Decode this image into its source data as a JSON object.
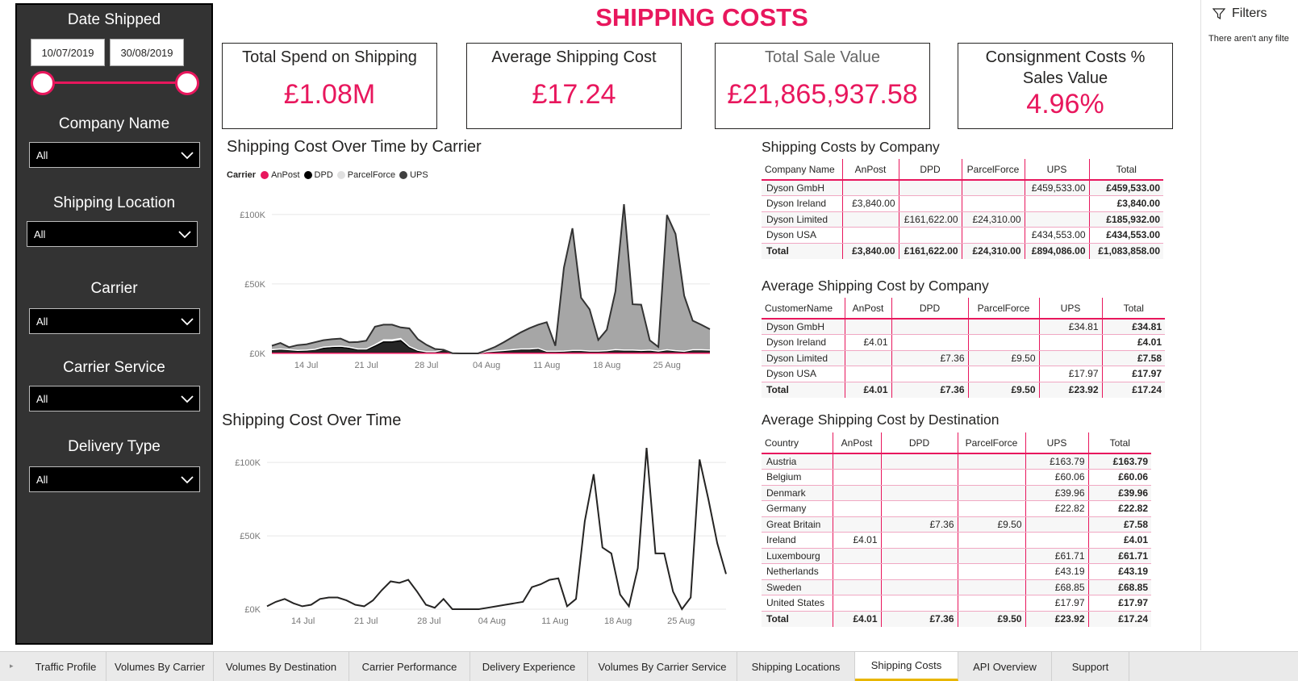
{
  "page": {
    "title": "SHIPPING COSTS"
  },
  "slicers": {
    "date_shipped": {
      "title": "Date Shipped",
      "start": "10/07/2019",
      "end": "30/08/2019"
    },
    "company_name": {
      "title": "Company Name",
      "value": "All"
    },
    "shipping_location": {
      "title": "Shipping Location",
      "value": "All"
    },
    "carrier": {
      "title": "Carrier",
      "value": "All"
    },
    "carrier_service": {
      "title": "Carrier Service",
      "value": "All"
    },
    "delivery_type": {
      "title": "Delivery Type",
      "value": "All"
    }
  },
  "cards": [
    {
      "label": "Total Spend on Shipping",
      "value": "£1.08M"
    },
    {
      "label": "Average Shipping Cost",
      "value": "£17.24"
    },
    {
      "label": "Total Sale Value",
      "value": "£21,865,937.58"
    },
    {
      "label": "Consignment Costs % Sales Value",
      "value": "4.96%"
    }
  ],
  "filters_pane": {
    "title": "Filters",
    "empty_text": "There aren't any filte"
  },
  "colors": {
    "accent": "#e8175d",
    "sidebar": "#333333",
    "anpost": "#e8175d",
    "dpd": "#000000",
    "parcelforce": "#e0e0e0",
    "ups": "#404040"
  },
  "chart_data": [
    {
      "type": "area",
      "title": "Shipping Cost Over Time by Carrier",
      "legend_title": "Carrier",
      "legend_position": "top-left",
      "x_ticks": [
        "14 Jul",
        "21 Jul",
        "28 Jul",
        "04 Aug",
        "11 Aug",
        "18 Aug",
        "25 Aug"
      ],
      "y_ticks": [
        "£0K",
        "£50K",
        "£100K"
      ],
      "ylim": [
        0,
        115000
      ],
      "grid": true,
      "stacked": true,
      "x_dates": [
        "10 Jul",
        "11 Jul",
        "12 Jul",
        "13 Jul",
        "14 Jul",
        "15 Jul",
        "16 Jul",
        "17 Jul",
        "18 Jul",
        "19 Jul",
        "20 Jul",
        "21 Jul",
        "22 Jul",
        "23 Jul",
        "24 Jul",
        "25 Jul",
        "26 Jul",
        "27 Jul",
        "28 Jul",
        "29 Jul",
        "30 Jul",
        "31 Jul",
        "01 Aug",
        "02 Aug",
        "03 Aug",
        "04 Aug",
        "05 Aug",
        "06 Aug",
        "07 Aug",
        "08 Aug",
        "09 Aug",
        "10 Aug",
        "11 Aug",
        "12 Aug",
        "13 Aug",
        "14 Aug",
        "15 Aug",
        "16 Aug",
        "17 Aug",
        "18 Aug",
        "19 Aug",
        "20 Aug",
        "21 Aug",
        "22 Aug",
        "23 Aug",
        "24 Aug",
        "25 Aug",
        "26 Aug",
        "27 Aug",
        "28 Aug",
        "29 Aug",
        "30 Aug"
      ],
      "series": [
        {
          "name": "AnPost",
          "values": [
            200,
            200,
            200,
            200,
            200,
            200,
            200,
            200,
            200,
            200,
            200,
            200,
            200,
            200,
            200,
            200,
            200,
            200,
            200,
            200,
            200,
            200,
            0,
            0,
            0,
            200,
            200,
            200,
            200,
            200,
            200,
            200,
            200,
            200,
            200,
            200,
            200,
            200,
            200,
            200,
            200,
            200,
            200,
            200,
            200,
            200,
            200,
            200,
            200,
            200,
            200,
            200
          ]
        },
        {
          "name": "DPD",
          "values": [
            2000,
            2500,
            2000,
            1500,
            1700,
            2200,
            3500,
            4000,
            4200,
            3500,
            2500,
            2500,
            5000,
            8000,
            8000,
            9000,
            4000,
            1500,
            800,
            800,
            2000,
            0,
            0,
            0,
            0,
            800,
            1200,
            1500,
            2000,
            2500,
            2500,
            3000,
            1000,
            1000,
            1200,
            1500,
            1500,
            1200,
            1200,
            1500,
            2000,
            1800,
            1800,
            1500,
            1800,
            1200,
            2000,
            1500,
            1000,
            2000,
            2000,
            1800
          ]
        },
        {
          "name": "ParcelForce",
          "values": [
            500,
            500,
            500,
            500,
            500,
            500,
            800,
            800,
            800,
            800,
            500,
            500,
            1000,
            1500,
            1500,
            1500,
            800,
            500,
            200,
            200,
            400,
            0,
            0,
            0,
            0,
            200,
            300,
            400,
            500,
            500,
            500,
            500,
            300,
            300,
            300,
            400,
            400,
            300,
            300,
            300,
            500,
            400,
            400,
            400,
            400,
            300,
            400,
            300,
            300,
            400,
            400,
            400
          ]
        },
        {
          "name": "UPS",
          "values": [
            2800,
            4300,
            1800,
            3800,
            4100,
            5100,
            5000,
            5200,
            5500,
            3500,
            5000,
            6000,
            13000,
            11000,
            11000,
            8000,
            13000,
            8000,
            5000,
            2000,
            0,
            0,
            0,
            0,
            0,
            1000,
            3000,
            6000,
            9000,
            12000,
            15000,
            17000,
            21000,
            4000,
            60000,
            88000,
            38000,
            30000,
            8000,
            15000,
            42000,
            105000,
            33000,
            33000,
            7000,
            3000,
            97000,
            84000,
            40000,
            21000,
            18000,
            15000
          ]
        }
      ]
    },
    {
      "type": "line",
      "title": "Shipping Cost Over Time",
      "x_ticks": [
        "14 Jul",
        "21 Jul",
        "28 Jul",
        "04 Aug",
        "11 Aug",
        "18 Aug",
        "25 Aug"
      ],
      "y_ticks": [
        "£0K",
        "£50K",
        "£100K"
      ],
      "ylim": [
        0,
        110000
      ],
      "grid": true,
      "x_dates": [
        "10 Jul",
        "11 Jul",
        "12 Jul",
        "13 Jul",
        "14 Jul",
        "15 Jul",
        "16 Jul",
        "17 Jul",
        "18 Jul",
        "19 Jul",
        "20 Jul",
        "21 Jul",
        "22 Jul",
        "23 Jul",
        "24 Jul",
        "25 Jul",
        "26 Jul",
        "27 Jul",
        "28 Jul",
        "29 Jul",
        "30 Jul",
        "31 Jul",
        "01 Aug",
        "02 Aug",
        "03 Aug",
        "04 Aug",
        "05 Aug",
        "06 Aug",
        "07 Aug",
        "08 Aug",
        "09 Aug",
        "10 Aug",
        "11 Aug",
        "12 Aug",
        "13 Aug",
        "14 Aug",
        "15 Aug",
        "16 Aug",
        "17 Aug",
        "18 Aug",
        "19 Aug",
        "20 Aug",
        "21 Aug",
        "22 Aug",
        "23 Aug",
        "24 Aug",
        "25 Aug",
        "26 Aug",
        "27 Aug",
        "28 Aug",
        "29 Aug",
        "30 Aug"
      ],
      "series": [
        {
          "name": "Total",
          "values": [
            2000,
            5000,
            7000,
            4000,
            2000,
            3000,
            7000,
            8000,
            8000,
            6000,
            3000,
            2000,
            6000,
            13000,
            19000,
            18000,
            20000,
            12000,
            3000,
            1000,
            7000,
            0,
            0,
            0,
            0,
            1000,
            2000,
            3000,
            4000,
            5000,
            15000,
            17000,
            20000,
            21000,
            2000,
            7000,
            60000,
            92000,
            42000,
            38000,
            10000,
            2000,
            28000,
            110000,
            38000,
            38000,
            12000,
            0,
            8000,
            102000,
            75000,
            45000,
            24000
          ]
        }
      ]
    }
  ],
  "tables": {
    "by_company": {
      "title": "Shipping Costs by Company",
      "headers": [
        "Company Name",
        "AnPost",
        "DPD",
        "ParcelForce",
        "UPS",
        "Total"
      ],
      "rows": [
        [
          "Dyson GmbH",
          "",
          "",
          "",
          "£459,533.00",
          "£459,533.00"
        ],
        [
          "Dyson Ireland",
          "£3,840.00",
          "",
          "",
          "",
          "£3,840.00"
        ],
        [
          "Dyson Limited",
          "",
          "£161,622.00",
          "£24,310.00",
          "",
          "£185,932.00"
        ],
        [
          "Dyson USA",
          "",
          "",
          "",
          "£434,553.00",
          "£434,553.00"
        ]
      ],
      "total": [
        "Total",
        "£3,840.00",
        "£161,622.00",
        "£24,310.00",
        "£894,086.00",
        "£1,083,858.00"
      ]
    },
    "avg_by_company": {
      "title": "Average Shipping Cost by Company",
      "headers": [
        "CustomerName",
        "AnPost",
        "DPD",
        "ParcelForce",
        "UPS",
        "Total"
      ],
      "rows": [
        [
          "Dyson GmbH",
          "",
          "",
          "",
          "£34.81",
          "£34.81"
        ],
        [
          "Dyson Ireland",
          "£4.01",
          "",
          "",
          "",
          "£4.01"
        ],
        [
          "Dyson Limited",
          "",
          "£7.36",
          "£9.50",
          "",
          "£7.58"
        ],
        [
          "Dyson USA",
          "",
          "",
          "",
          "£17.97",
          "£17.97"
        ]
      ],
      "total": [
        "Total",
        "£4.01",
        "£7.36",
        "£9.50",
        "£23.92",
        "£17.24"
      ]
    },
    "avg_by_destination": {
      "title": "Average Shipping Cost by Destination",
      "headers": [
        "Country",
        "AnPost",
        "DPD",
        "ParcelForce",
        "UPS",
        "Total"
      ],
      "rows": [
        [
          "Austria",
          "",
          "",
          "",
          "£163.79",
          "£163.79"
        ],
        [
          "Belgium",
          "",
          "",
          "",
          "£60.06",
          "£60.06"
        ],
        [
          "Denmark",
          "",
          "",
          "",
          "£39.96",
          "£39.96"
        ],
        [
          "Germany",
          "",
          "",
          "",
          "£22.82",
          "£22.82"
        ],
        [
          "Great Britain",
          "",
          "£7.36",
          "£9.50",
          "",
          "£7.58"
        ],
        [
          "Ireland",
          "£4.01",
          "",
          "",
          "",
          "£4.01"
        ],
        [
          "Luxembourg",
          "",
          "",
          "",
          "£61.71",
          "£61.71"
        ],
        [
          "Netherlands",
          "",
          "",
          "",
          "£43.19",
          "£43.19"
        ],
        [
          "Sweden",
          "",
          "",
          "",
          "£68.85",
          "£68.85"
        ],
        [
          "United States",
          "",
          "",
          "",
          "£17.97",
          "£17.97"
        ]
      ],
      "total": [
        "Total",
        "£4.01",
        "£7.36",
        "£9.50",
        "£23.92",
        "£17.24"
      ]
    }
  },
  "tabs": [
    "Traffic Profile",
    "Volumes By Carrier",
    "Volumes By Destination",
    "Carrier Performance",
    "Delivery Experience",
    "Volumes By Carrier Service",
    "Shipping Locations",
    "Shipping Costs",
    "API Overview",
    "Support"
  ],
  "active_tab": "Shipping Costs"
}
